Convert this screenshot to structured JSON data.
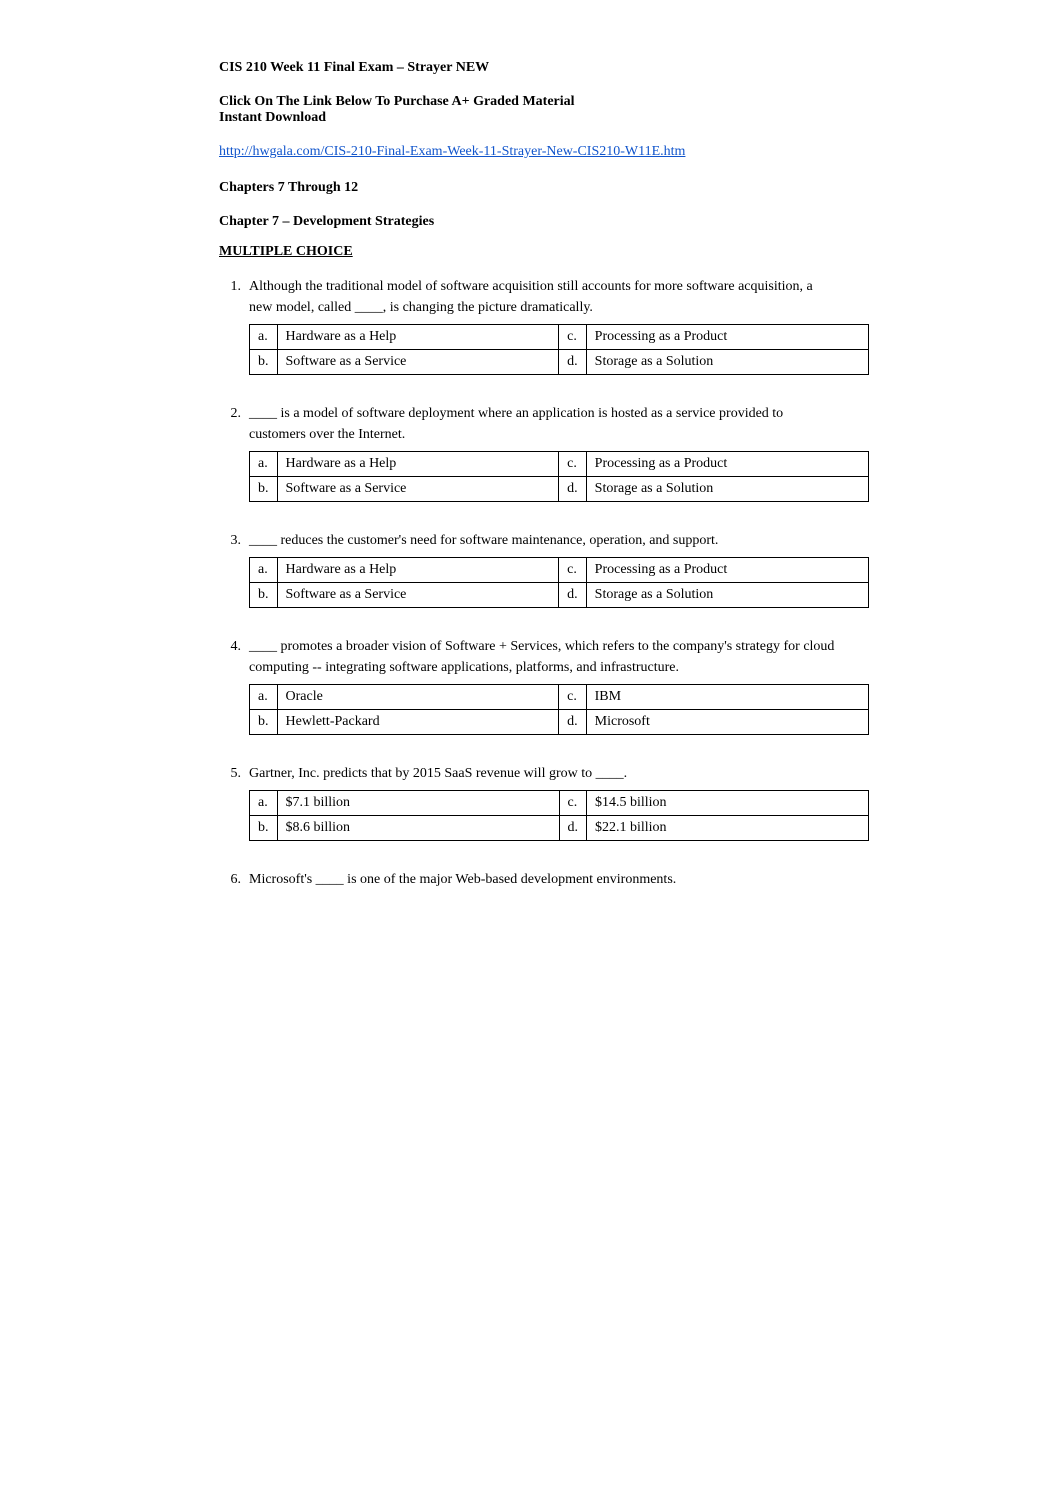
{
  "page": {
    "title": "CIS 210 Week 11 Final Exam – Strayer NEW",
    "purchase_line1": "Click On The Link Below To Purchase A+ Graded Material",
    "purchase_line2": "Instant Download",
    "link_text": "http://hwgala.com/CIS-210-Final-Exam-Week-11-Strayer-New-CIS210-W11E.htm",
    "link_href": "http://hwgala.com/CIS-210-Final-Exam-Week-11-Strayer-New-CIS210-W11E.htm",
    "chapters_range": "Chapters 7 Through 12",
    "chapter_title": "Chapter 7 – Development Strategies",
    "section": "MULTIPLE CHOICE",
    "questions": [
      {
        "num": "1.",
        "text": "Although the traditional model of software acquisition still accounts for more software acquisition, a new model, called ____, is changing the picture dramatically.",
        "answers": [
          {
            "label": "a.",
            "text": "Hardware as a Help"
          },
          {
            "label": "c.",
            "text": "Processing as a Product"
          },
          {
            "label": "b.",
            "text": "Software as a Service"
          },
          {
            "label": "d.",
            "text": "Storage as a Solution"
          }
        ]
      },
      {
        "num": "2.",
        "text": "____ is a model of software deployment where an application is hosted as a service provided to customers over the Internet.",
        "answers": [
          {
            "label": "a.",
            "text": "Hardware as a Help"
          },
          {
            "label": "c.",
            "text": "Processing as a Product"
          },
          {
            "label": "b.",
            "text": "Software as a Service"
          },
          {
            "label": "d.",
            "text": "Storage as a Solution"
          }
        ]
      },
      {
        "num": "3.",
        "text": "____ reduces the customer's need for software maintenance, operation, and support.",
        "answers": [
          {
            "label": "a.",
            "text": "Hardware as a Help"
          },
          {
            "label": "c.",
            "text": "Processing as a Product"
          },
          {
            "label": "b.",
            "text": "Software as a Service"
          },
          {
            "label": "d.",
            "text": "Storage as a Solution"
          }
        ]
      },
      {
        "num": "4.",
        "text": "____ promotes a broader vision of Software + Services, which refers to the company's strategy for cloud computing -- integrating software applications, platforms, and infrastructure.",
        "answers": [
          {
            "label": "a.",
            "text": "Oracle"
          },
          {
            "label": "c.",
            "text": "IBM"
          },
          {
            "label": "b.",
            "text": "Hewlett-Packard"
          },
          {
            "label": "d.",
            "text": "Microsoft"
          }
        ]
      },
      {
        "num": "5.",
        "text": "Gartner, Inc. predicts that by 2015 SaaS revenue will grow to ____.",
        "answers": [
          {
            "label": "a.",
            "text": "$7.1 billion"
          },
          {
            "label": "c.",
            "text": "$14.5 billion"
          },
          {
            "label": "b.",
            "text": "$8.6 billion"
          },
          {
            "label": "d.",
            "text": "$22.1 billion"
          }
        ]
      },
      {
        "num": "6.",
        "text": "Microsoft's ____ is one of the major Web-based development environments.",
        "answers": []
      }
    ]
  }
}
